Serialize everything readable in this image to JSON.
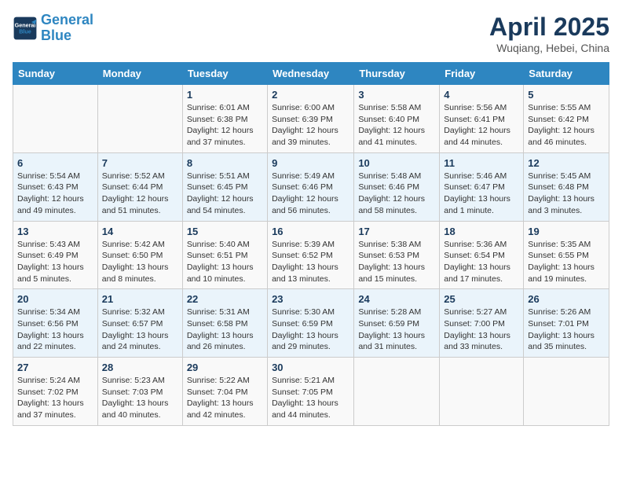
{
  "header": {
    "logo_line1": "General",
    "logo_line2": "Blue",
    "month": "April 2025",
    "location": "Wuqiang, Hebei, China"
  },
  "weekdays": [
    "Sunday",
    "Monday",
    "Tuesday",
    "Wednesday",
    "Thursday",
    "Friday",
    "Saturday"
  ],
  "weeks": [
    [
      {
        "day": "",
        "info": ""
      },
      {
        "day": "",
        "info": ""
      },
      {
        "day": "1",
        "info": "Sunrise: 6:01 AM\nSunset: 6:38 PM\nDaylight: 12 hours and 37 minutes."
      },
      {
        "day": "2",
        "info": "Sunrise: 6:00 AM\nSunset: 6:39 PM\nDaylight: 12 hours and 39 minutes."
      },
      {
        "day": "3",
        "info": "Sunrise: 5:58 AM\nSunset: 6:40 PM\nDaylight: 12 hours and 41 minutes."
      },
      {
        "day": "4",
        "info": "Sunrise: 5:56 AM\nSunset: 6:41 PM\nDaylight: 12 hours and 44 minutes."
      },
      {
        "day": "5",
        "info": "Sunrise: 5:55 AM\nSunset: 6:42 PM\nDaylight: 12 hours and 46 minutes."
      }
    ],
    [
      {
        "day": "6",
        "info": "Sunrise: 5:54 AM\nSunset: 6:43 PM\nDaylight: 12 hours and 49 minutes."
      },
      {
        "day": "7",
        "info": "Sunrise: 5:52 AM\nSunset: 6:44 PM\nDaylight: 12 hours and 51 minutes."
      },
      {
        "day": "8",
        "info": "Sunrise: 5:51 AM\nSunset: 6:45 PM\nDaylight: 12 hours and 54 minutes."
      },
      {
        "day": "9",
        "info": "Sunrise: 5:49 AM\nSunset: 6:46 PM\nDaylight: 12 hours and 56 minutes."
      },
      {
        "day": "10",
        "info": "Sunrise: 5:48 AM\nSunset: 6:46 PM\nDaylight: 12 hours and 58 minutes."
      },
      {
        "day": "11",
        "info": "Sunrise: 5:46 AM\nSunset: 6:47 PM\nDaylight: 13 hours and 1 minute."
      },
      {
        "day": "12",
        "info": "Sunrise: 5:45 AM\nSunset: 6:48 PM\nDaylight: 13 hours and 3 minutes."
      }
    ],
    [
      {
        "day": "13",
        "info": "Sunrise: 5:43 AM\nSunset: 6:49 PM\nDaylight: 13 hours and 5 minutes."
      },
      {
        "day": "14",
        "info": "Sunrise: 5:42 AM\nSunset: 6:50 PM\nDaylight: 13 hours and 8 minutes."
      },
      {
        "day": "15",
        "info": "Sunrise: 5:40 AM\nSunset: 6:51 PM\nDaylight: 13 hours and 10 minutes."
      },
      {
        "day": "16",
        "info": "Sunrise: 5:39 AM\nSunset: 6:52 PM\nDaylight: 13 hours and 13 minutes."
      },
      {
        "day": "17",
        "info": "Sunrise: 5:38 AM\nSunset: 6:53 PM\nDaylight: 13 hours and 15 minutes."
      },
      {
        "day": "18",
        "info": "Sunrise: 5:36 AM\nSunset: 6:54 PM\nDaylight: 13 hours and 17 minutes."
      },
      {
        "day": "19",
        "info": "Sunrise: 5:35 AM\nSunset: 6:55 PM\nDaylight: 13 hours and 19 minutes."
      }
    ],
    [
      {
        "day": "20",
        "info": "Sunrise: 5:34 AM\nSunset: 6:56 PM\nDaylight: 13 hours and 22 minutes."
      },
      {
        "day": "21",
        "info": "Sunrise: 5:32 AM\nSunset: 6:57 PM\nDaylight: 13 hours and 24 minutes."
      },
      {
        "day": "22",
        "info": "Sunrise: 5:31 AM\nSunset: 6:58 PM\nDaylight: 13 hours and 26 minutes."
      },
      {
        "day": "23",
        "info": "Sunrise: 5:30 AM\nSunset: 6:59 PM\nDaylight: 13 hours and 29 minutes."
      },
      {
        "day": "24",
        "info": "Sunrise: 5:28 AM\nSunset: 6:59 PM\nDaylight: 13 hours and 31 minutes."
      },
      {
        "day": "25",
        "info": "Sunrise: 5:27 AM\nSunset: 7:00 PM\nDaylight: 13 hours and 33 minutes."
      },
      {
        "day": "26",
        "info": "Sunrise: 5:26 AM\nSunset: 7:01 PM\nDaylight: 13 hours and 35 minutes."
      }
    ],
    [
      {
        "day": "27",
        "info": "Sunrise: 5:24 AM\nSunset: 7:02 PM\nDaylight: 13 hours and 37 minutes."
      },
      {
        "day": "28",
        "info": "Sunrise: 5:23 AM\nSunset: 7:03 PM\nDaylight: 13 hours and 40 minutes."
      },
      {
        "day": "29",
        "info": "Sunrise: 5:22 AM\nSunset: 7:04 PM\nDaylight: 13 hours and 42 minutes."
      },
      {
        "day": "30",
        "info": "Sunrise: 5:21 AM\nSunset: 7:05 PM\nDaylight: 13 hours and 44 minutes."
      },
      {
        "day": "",
        "info": ""
      },
      {
        "day": "",
        "info": ""
      },
      {
        "day": "",
        "info": ""
      }
    ]
  ]
}
